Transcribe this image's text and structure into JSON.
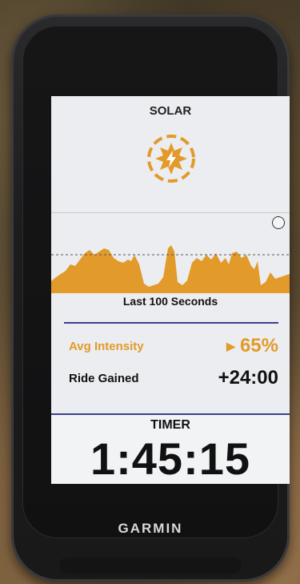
{
  "device": {
    "brand": "GARMIN"
  },
  "solar": {
    "title": "SOLAR",
    "icon": "solar-charging-icon"
  },
  "chart": {
    "label": "Last 100 Seconds",
    "zoom_icon": "fit-width-icon",
    "fill_color": "#e29a2a",
    "avg_line_style": "dashed"
  },
  "stats": {
    "avg_intensity": {
      "label": "Avg Intensity",
      "value": "65%",
      "icon": "play-triangle-icon",
      "color": "#e29a2a"
    },
    "ride_gained": {
      "label": "Ride Gained",
      "value": "+24:00"
    }
  },
  "timer": {
    "label": "TIMER",
    "value": "1:45:15"
  },
  "colors": {
    "accent": "#e29a2a",
    "divider": "#3b3f8c",
    "screen_bg": "#ecedf0"
  }
}
